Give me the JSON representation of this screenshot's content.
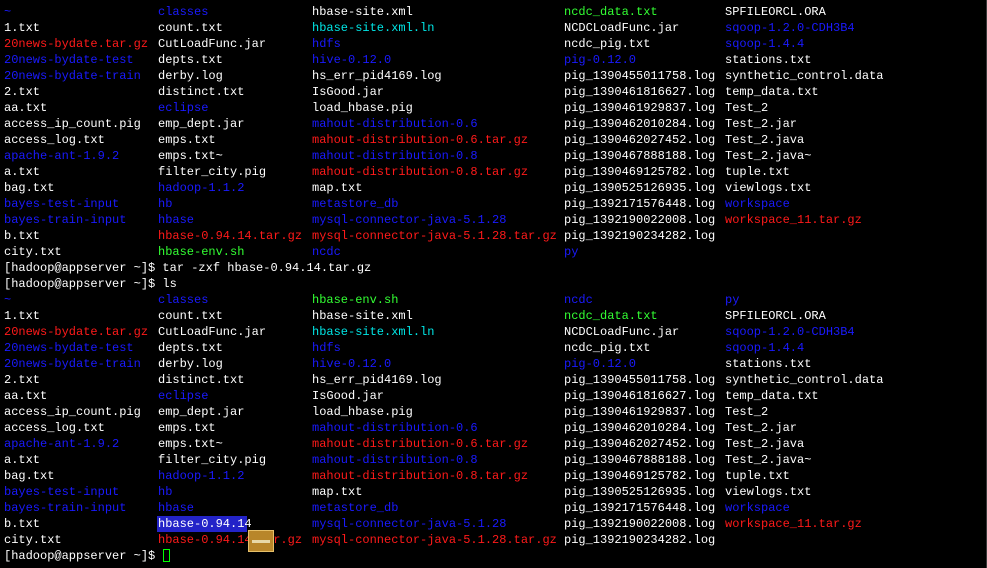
{
  "colors": {
    "background": "#000000",
    "white": "#ffffff",
    "directory_blue": "#1a1aff",
    "archive_red": "#ff1a1a",
    "link_cyan": "#00e5e5",
    "green_file": "#33ff33",
    "cursor_green": "#00ff00",
    "selection_blue": "#2323c8"
  },
  "listing1": [
    [
      {
        "t": "~",
        "c": "directory_blue"
      },
      {
        "t": "classes",
        "c": "directory_blue"
      },
      {
        "t": "hbase-site.xml",
        "c": "white"
      },
      {
        "t": "ncdc_data.txt",
        "c": "green_file"
      },
      {
        "t": "SPFILEORCL.ORA",
        "c": "white"
      }
    ],
    [
      {
        "t": "1.txt",
        "c": "white"
      },
      {
        "t": "count.txt",
        "c": "white"
      },
      {
        "t": "hbase-site.xml.ln",
        "c": "link_cyan"
      },
      {
        "t": "NCDCLoadFunc.jar",
        "c": "white"
      },
      {
        "t": "sqoop-1.2.0-CDH3B4",
        "c": "directory_blue"
      }
    ],
    [
      {
        "t": "20news-bydate.tar.gz",
        "c": "archive_red"
      },
      {
        "t": "CutLoadFunc.jar",
        "c": "white"
      },
      {
        "t": "hdfs",
        "c": "directory_blue"
      },
      {
        "t": "ncdc_pig.txt",
        "c": "white"
      },
      {
        "t": "sqoop-1.4.4",
        "c": "directory_blue"
      }
    ],
    [
      {
        "t": "20news-bydate-test",
        "c": "directory_blue"
      },
      {
        "t": "depts.txt",
        "c": "white"
      },
      {
        "t": "hive-0.12.0",
        "c": "directory_blue"
      },
      {
        "t": "pig-0.12.0",
        "c": "directory_blue"
      },
      {
        "t": "stations.txt",
        "c": "white"
      }
    ],
    [
      {
        "t": "20news-bydate-train",
        "c": "directory_blue"
      },
      {
        "t": "derby.log",
        "c": "white"
      },
      {
        "t": "hs_err_pid4169.log",
        "c": "white"
      },
      {
        "t": "pig_1390455011758.log",
        "c": "white"
      },
      {
        "t": "synthetic_control.data",
        "c": "white"
      }
    ],
    [
      {
        "t": "2.txt",
        "c": "white"
      },
      {
        "t": "distinct.txt",
        "c": "white"
      },
      {
        "t": "IsGood.jar",
        "c": "white"
      },
      {
        "t": "pig_1390461816627.log",
        "c": "white"
      },
      {
        "t": "temp_data.txt",
        "c": "white"
      }
    ],
    [
      {
        "t": "aa.txt",
        "c": "white"
      },
      {
        "t": "eclipse",
        "c": "directory_blue"
      },
      {
        "t": "load_hbase.pig",
        "c": "white"
      },
      {
        "t": "pig_1390461929837.log",
        "c": "white"
      },
      {
        "t": "Test_2",
        "c": "white"
      }
    ],
    [
      {
        "t": "access_ip_count.pig",
        "c": "white"
      },
      {
        "t": "emp_dept.jar",
        "c": "white"
      },
      {
        "t": "mahout-distribution-0.6",
        "c": "directory_blue"
      },
      {
        "t": "pig_1390462010284.log",
        "c": "white"
      },
      {
        "t": "Test_2.jar",
        "c": "white"
      }
    ],
    [
      {
        "t": "access_log.txt",
        "c": "white"
      },
      {
        "t": "emps.txt",
        "c": "white"
      },
      {
        "t": "mahout-distribution-0.6.tar.gz",
        "c": "archive_red"
      },
      {
        "t": "pig_1390462027452.log",
        "c": "white"
      },
      {
        "t": "Test_2.java",
        "c": "white"
      }
    ],
    [
      {
        "t": "apache-ant-1.9.2",
        "c": "directory_blue"
      },
      {
        "t": "emps.txt~",
        "c": "white"
      },
      {
        "t": "mahout-distribution-0.8",
        "c": "directory_blue"
      },
      {
        "t": "pig_1390467888188.log",
        "c": "white"
      },
      {
        "t": "Test_2.java~",
        "c": "white"
      }
    ],
    [
      {
        "t": "a.txt",
        "c": "white"
      },
      {
        "t": "filter_city.pig",
        "c": "white"
      },
      {
        "t": "mahout-distribution-0.8.tar.gz",
        "c": "archive_red"
      },
      {
        "t": "pig_1390469125782.log",
        "c": "white"
      },
      {
        "t": "tuple.txt",
        "c": "white"
      }
    ],
    [
      {
        "t": "bag.txt",
        "c": "white"
      },
      {
        "t": "hadoop-1.1.2",
        "c": "directory_blue"
      },
      {
        "t": "map.txt",
        "c": "white"
      },
      {
        "t": "pig_1390525126935.log",
        "c": "white"
      },
      {
        "t": "viewlogs.txt",
        "c": "white"
      }
    ],
    [
      {
        "t": "bayes-test-input",
        "c": "directory_blue"
      },
      {
        "t": "hb",
        "c": "directory_blue"
      },
      {
        "t": "metastore_db",
        "c": "directory_blue"
      },
      {
        "t": "pig_1392171576448.log",
        "c": "white"
      },
      {
        "t": "workspace",
        "c": "directory_blue"
      }
    ],
    [
      {
        "t": "bayes-train-input",
        "c": "directory_blue"
      },
      {
        "t": "hbase",
        "c": "directory_blue"
      },
      {
        "t": "mysql-connector-java-5.1.28",
        "c": "directory_blue"
      },
      {
        "t": "pig_1392190022008.log",
        "c": "white"
      },
      {
        "t": "workspace_11.tar.gz",
        "c": "archive_red"
      }
    ],
    [
      {
        "t": "b.txt",
        "c": "white"
      },
      {
        "t": "hbase-0.94.14.tar.gz",
        "c": "archive_red"
      },
      {
        "t": "mysql-connector-java-5.1.28.tar.gz",
        "c": "archive_red"
      },
      {
        "t": "pig_1392190234282.log",
        "c": "white"
      },
      {
        "t": "",
        "c": "white"
      }
    ],
    [
      {
        "t": "city.txt",
        "c": "white"
      },
      {
        "t": "hbase-env.sh",
        "c": "green_file"
      },
      {
        "t": "ncdc",
        "c": "directory_blue"
      },
      {
        "t": "py",
        "c": "directory_blue"
      },
      {
        "t": "",
        "c": "white"
      }
    ]
  ],
  "command1": "[hadoop@appserver ~]$ tar -zxf hbase-0.94.14.tar.gz",
  "command2": "[hadoop@appserver ~]$ ls",
  "listing2": [
    [
      {
        "t": "~",
        "c": "directory_blue"
      },
      {
        "t": "classes",
        "c": "directory_blue"
      },
      {
        "t": "hbase-env.sh",
        "c": "green_file"
      },
      {
        "t": "ncdc",
        "c": "directory_blue"
      },
      {
        "t": "py",
        "c": "directory_blue"
      }
    ],
    [
      {
        "t": "1.txt",
        "c": "white"
      },
      {
        "t": "count.txt",
        "c": "white"
      },
      {
        "t": "hbase-site.xml",
        "c": "white"
      },
      {
        "t": "ncdc_data.txt",
        "c": "green_file"
      },
      {
        "t": "SPFILEORCL.ORA",
        "c": "white"
      }
    ],
    [
      {
        "t": "20news-bydate.tar.gz",
        "c": "archive_red"
      },
      {
        "t": "CutLoadFunc.jar",
        "c": "white"
      },
      {
        "t": "hbase-site.xml.ln",
        "c": "link_cyan"
      },
      {
        "t": "NCDCLoadFunc.jar",
        "c": "white"
      },
      {
        "t": "sqoop-1.2.0-CDH3B4",
        "c": "directory_blue"
      }
    ],
    [
      {
        "t": "20news-bydate-test",
        "c": "directory_blue"
      },
      {
        "t": "depts.txt",
        "c": "white"
      },
      {
        "t": "hdfs",
        "c": "directory_blue"
      },
      {
        "t": "ncdc_pig.txt",
        "c": "white"
      },
      {
        "t": "sqoop-1.4.4",
        "c": "directory_blue"
      }
    ],
    [
      {
        "t": "20news-bydate-train",
        "c": "directory_blue"
      },
      {
        "t": "derby.log",
        "c": "white"
      },
      {
        "t": "hive-0.12.0",
        "c": "directory_blue"
      },
      {
        "t": "pig-0.12.0",
        "c": "directory_blue"
      },
      {
        "t": "stations.txt",
        "c": "white"
      }
    ],
    [
      {
        "t": "2.txt",
        "c": "white"
      },
      {
        "t": "distinct.txt",
        "c": "white"
      },
      {
        "t": "hs_err_pid4169.log",
        "c": "white"
      },
      {
        "t": "pig_1390455011758.log",
        "c": "white"
      },
      {
        "t": "synthetic_control.data",
        "c": "white"
      }
    ],
    [
      {
        "t": "aa.txt",
        "c": "white"
      },
      {
        "t": "eclipse",
        "c": "directory_blue"
      },
      {
        "t": "IsGood.jar",
        "c": "white"
      },
      {
        "t": "pig_1390461816627.log",
        "c": "white"
      },
      {
        "t": "temp_data.txt",
        "c": "white"
      }
    ],
    [
      {
        "t": "access_ip_count.pig",
        "c": "white"
      },
      {
        "t": "emp_dept.jar",
        "c": "white"
      },
      {
        "t": "load_hbase.pig",
        "c": "white"
      },
      {
        "t": "pig_1390461929837.log",
        "c": "white"
      },
      {
        "t": "Test_2",
        "c": "white"
      }
    ],
    [
      {
        "t": "access_log.txt",
        "c": "white"
      },
      {
        "t": "emps.txt",
        "c": "white"
      },
      {
        "t": "mahout-distribution-0.6",
        "c": "directory_blue"
      },
      {
        "t": "pig_1390462010284.log",
        "c": "white"
      },
      {
        "t": "Test_2.jar",
        "c": "white"
      }
    ],
    [
      {
        "t": "apache-ant-1.9.2",
        "c": "directory_blue"
      },
      {
        "t": "emps.txt~",
        "c": "white"
      },
      {
        "t": "mahout-distribution-0.6.tar.gz",
        "c": "archive_red"
      },
      {
        "t": "pig_1390462027452.log",
        "c": "white"
      },
      {
        "t": "Test_2.java",
        "c": "white"
      }
    ],
    [
      {
        "t": "a.txt",
        "c": "white"
      },
      {
        "t": "filter_city.pig",
        "c": "white"
      },
      {
        "t": "mahout-distribution-0.8",
        "c": "directory_blue"
      },
      {
        "t": "pig_1390467888188.log",
        "c": "white"
      },
      {
        "t": "Test_2.java~",
        "c": "white"
      }
    ],
    [
      {
        "t": "bag.txt",
        "c": "white"
      },
      {
        "t": "hadoop-1.1.2",
        "c": "directory_blue"
      },
      {
        "t": "mahout-distribution-0.8.tar.gz",
        "c": "archive_red"
      },
      {
        "t": "pig_1390469125782.log",
        "c": "white"
      },
      {
        "t": "tuple.txt",
        "c": "white"
      }
    ],
    [
      {
        "t": "bayes-test-input",
        "c": "directory_blue"
      },
      {
        "t": "hb",
        "c": "directory_blue"
      },
      {
        "t": "map.txt",
        "c": "white"
      },
      {
        "t": "pig_1390525126935.log",
        "c": "white"
      },
      {
        "t": "viewlogs.txt",
        "c": "white"
      }
    ],
    [
      {
        "t": "bayes-train-input",
        "c": "directory_blue"
      },
      {
        "t": "hbase",
        "c": "directory_blue"
      },
      {
        "t": "metastore_db",
        "c": "directory_blue"
      },
      {
        "t": "pig_1392171576448.log",
        "c": "white"
      },
      {
        "t": "workspace",
        "c": "directory_blue"
      }
    ],
    [
      {
        "t": "b.txt",
        "c": "white"
      },
      {
        "t": "hbase-0.94.14",
        "c": "directory_blue"
      },
      {
        "t": "mysql-connector-java-5.1.28",
        "c": "directory_blue"
      },
      {
        "t": "pig_1392190022008.log",
        "c": "white"
      },
      {
        "t": "workspace_11.tar.gz",
        "c": "archive_red"
      }
    ],
    [
      {
        "t": "city.txt",
        "c": "white"
      },
      {
        "t": "hbase-0.94.14.tar.gz",
        "c": "archive_red"
      },
      {
        "t": "mysql-connector-java-5.1.28.tar.gz",
        "c": "archive_red"
      },
      {
        "t": "pig_1392190234282.log",
        "c": "white"
      },
      {
        "t": "",
        "c": "white"
      }
    ]
  ],
  "prompt_final": "[hadoop@appserver ~]$ ",
  "cursor_icon": "block-cursor-icon",
  "drag_icon": "file-drag-icon"
}
